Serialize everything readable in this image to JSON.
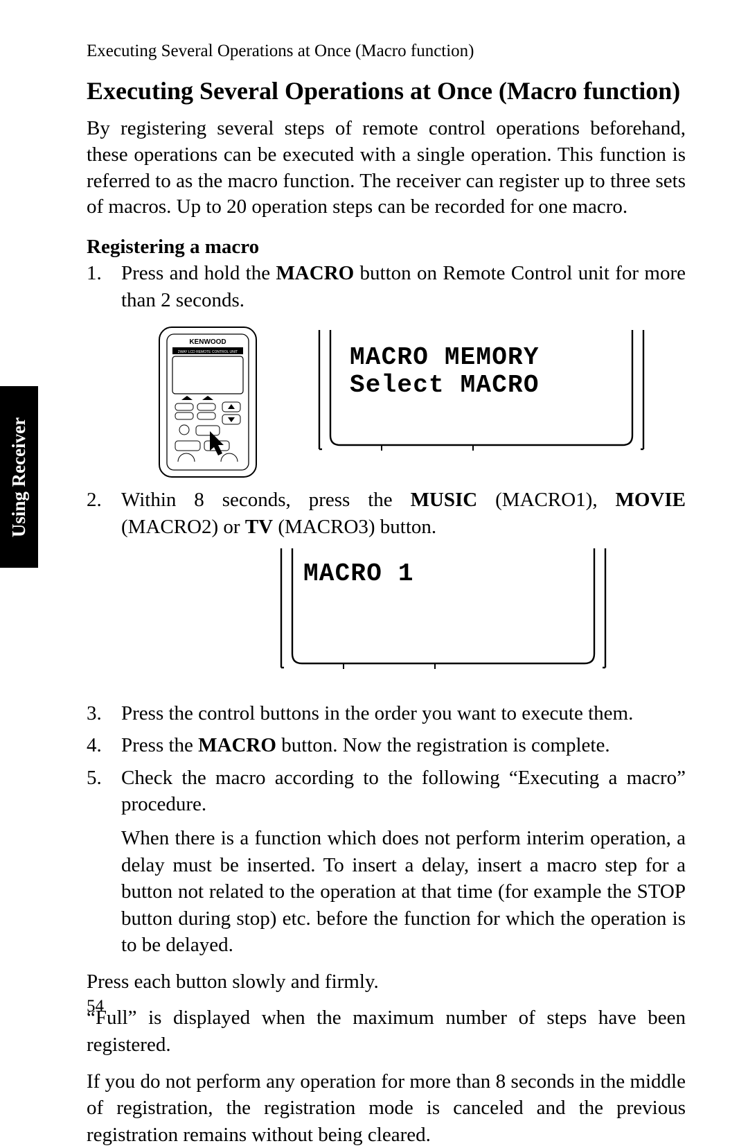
{
  "running_head": "Executing Several Operations at Once (Macro function)",
  "title": "Executing Several Operations at Once (Macro function)",
  "intro": "By registering several steps of remote control operations beforehand, these operations can be executed with a single operation. This function is referred to as the macro function. The receiver can register up to three sets of macros. Up to 20 operation steps can be recorded for one macro.",
  "subhead": "Registering a macro",
  "step1_pre": "Press and hold the ",
  "step1_b1": "MACRO",
  "step1_post": " button on Remote Control unit for more than 2 seconds.",
  "remote_brand": "KENWOOD",
  "remote_small_label": "2WAY LCD REMOTE CONTROL UNIT",
  "lcd1_line1": "MACRO MEMORY",
  "lcd1_line2": "Select MACRO",
  "step2_pre": "Within 8 seconds, press the ",
  "step2_b1": "MUSIC",
  "step2_mid1": " (MACRO1), ",
  "step2_b2": "MOVIE",
  "step2_mid2": " (MACRO2) or ",
  "step2_b3": "TV",
  "step2_post": " (MACRO3) button.",
  "lcd2_line1": "MACRO 1",
  "step3": "Press the control buttons in the order you want to execute them.",
  "step4_pre": "Press the ",
  "step4_b1": "MACRO",
  "step4_post": " button. Now the registration is complete.",
  "step5": "Check the macro according to the following “Executing a macro” procedure.",
  "step5_extra": "When there is a function which does not perform interim operation, a delay must be inserted. To insert a delay, insert a macro step for a button not related to the operation at that time (for example the STOP button during stop) etc. before the function for which the operation is to be delayed.",
  "tail1": "Press each button slowly and firmly.",
  "tail2": "“Full” is displayed when the maximum number of steps have been registered.",
  "tail3": "If you do not perform any operation for more than 8 seconds in the middle of registration, the registration mode is canceled and the previous registration remains without being cleared.",
  "sidetab": "Using Receiver",
  "pagenum": "54"
}
